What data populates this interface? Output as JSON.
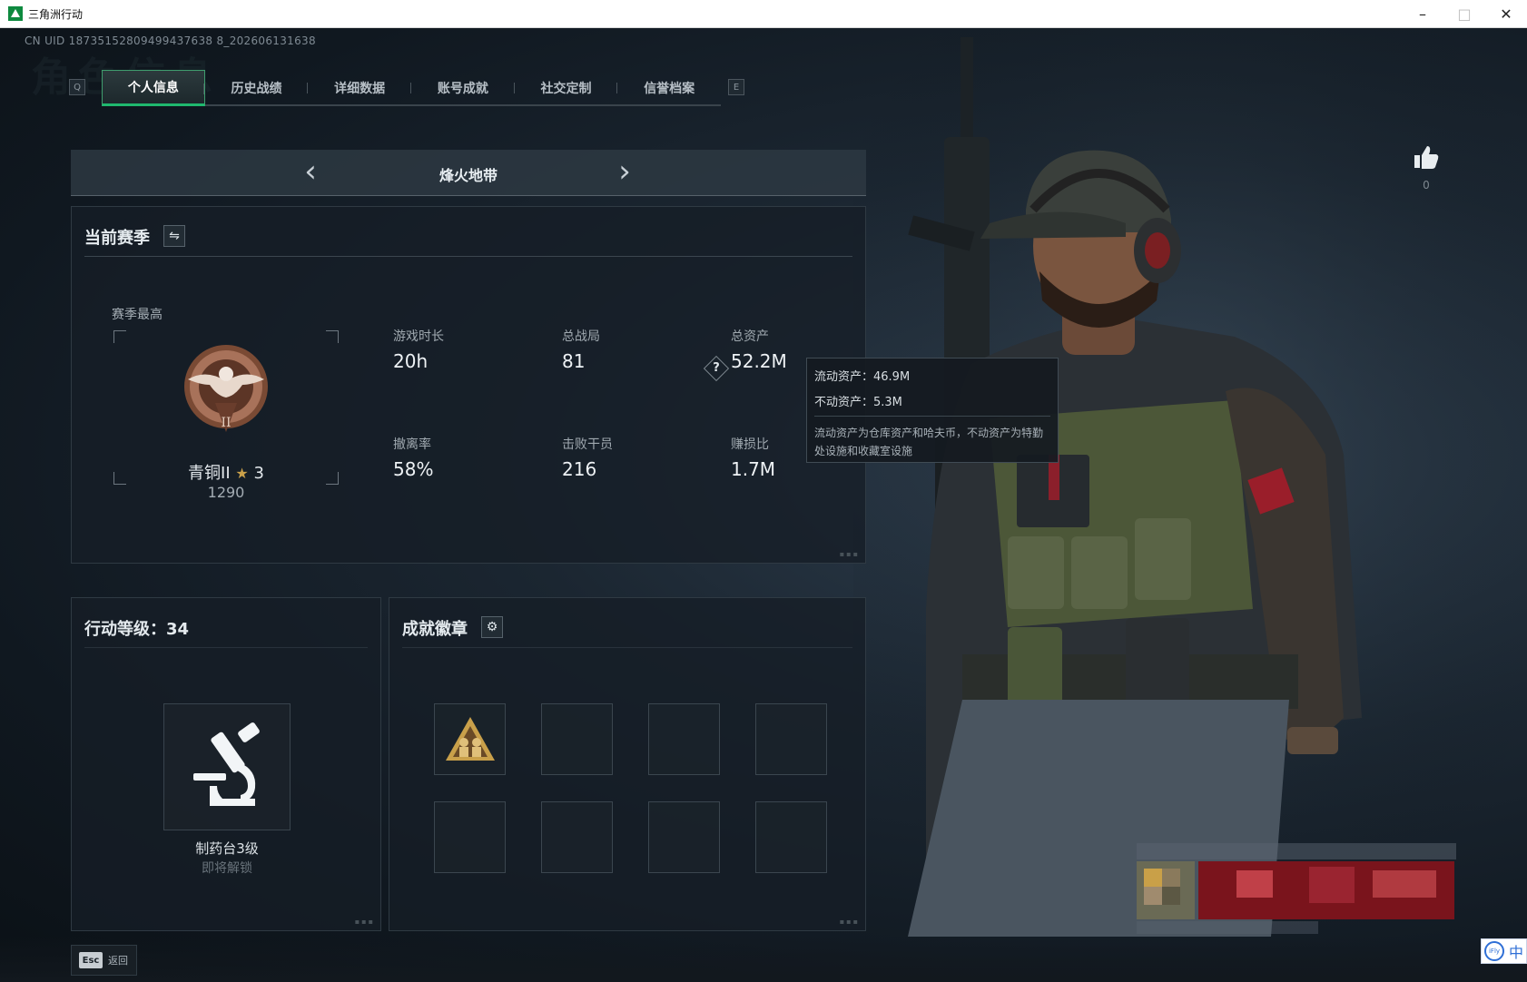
{
  "window": {
    "title": "三角洲行动",
    "controls": [
      "–",
      "□",
      "✕"
    ]
  },
  "uid": "CN UID 18735152809499437638 8_202606131638",
  "tabs": {
    "left_key": "Q",
    "right_key": "E",
    "items": [
      "个人信息",
      "历史战绩",
      "详细数据",
      "账号成就",
      "社交定制",
      "信誉档案"
    ],
    "active": 0
  },
  "mode": {
    "title": "烽火地带",
    "prev_icon": "chevron-left-icon",
    "next_icon": "chevron-right-icon"
  },
  "season": {
    "title": "当前赛季",
    "best_label": "赛季最高",
    "rank_name": "青铜II",
    "rank_stars": "3",
    "rank_score": "1290",
    "stats": [
      {
        "label": "游戏时长",
        "value": "20h"
      },
      {
        "label": "总战局",
        "value": "81"
      },
      {
        "label": "总资产",
        "value": "52.2M"
      },
      {
        "label": "撤离率",
        "value": "58%"
      },
      {
        "label": "击败干员",
        "value": "216"
      },
      {
        "label": "赚损比",
        "value": "1.7M"
      }
    ]
  },
  "tooltip": {
    "liquid": "流动资产：46.9M",
    "fixed": "不动资产：5.3M",
    "desc": "流动资产为仓库资产和哈夫币，不动资产为特勤处设施和收藏室设施"
  },
  "level": {
    "title": "行动等级：34",
    "item_name": "制药台3级",
    "item_status": "即将解锁"
  },
  "badges": {
    "title": "成就徽章"
  },
  "like": {
    "count": "0"
  },
  "esc": {
    "key": "Esc",
    "label": "返回"
  },
  "ime": {
    "label": "中"
  },
  "colors": {
    "accent": "#1fb86e",
    "bronze": "#8a5a3e",
    "badge_gold": "#c9a04a"
  }
}
